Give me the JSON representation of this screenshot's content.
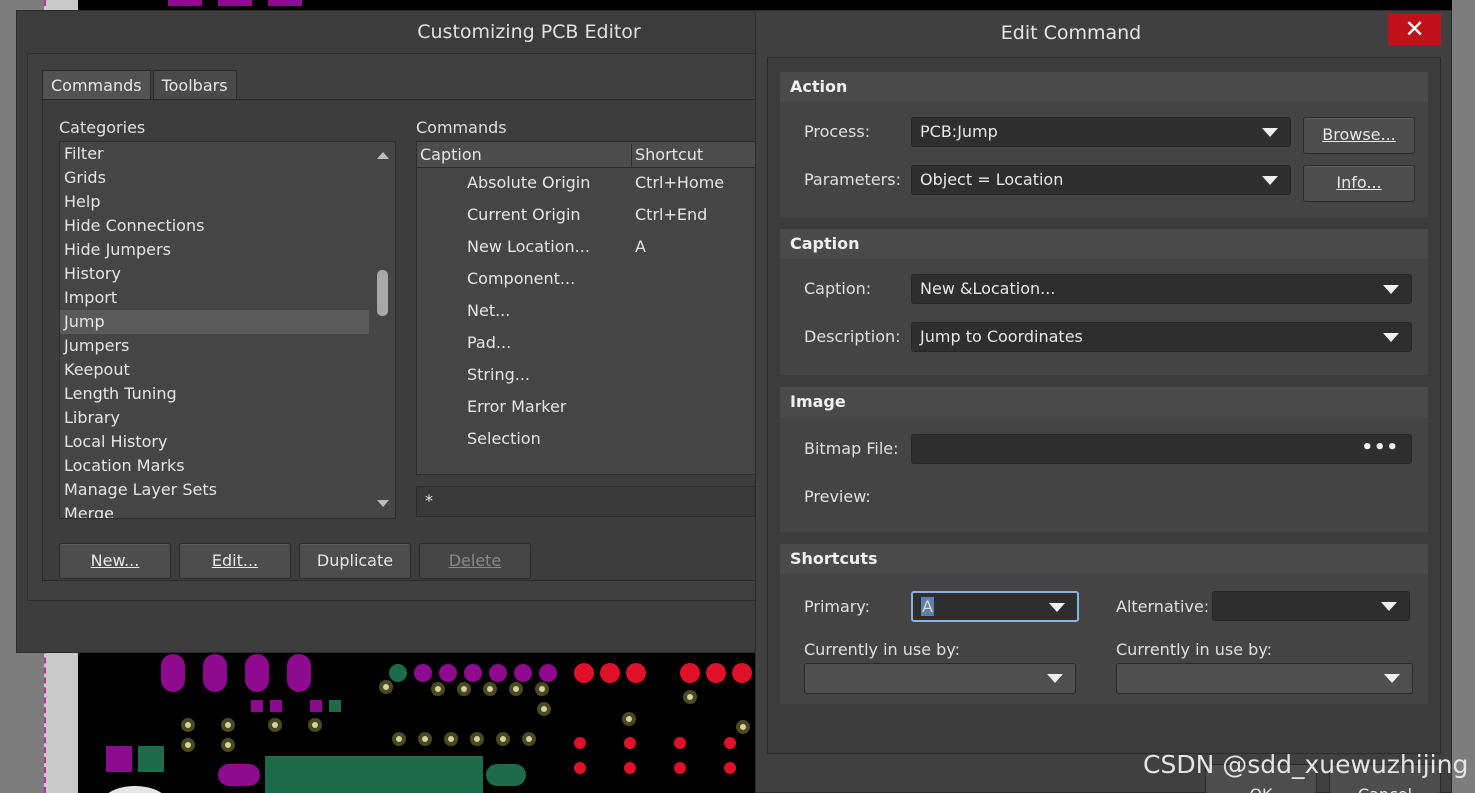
{
  "customize_dialog": {
    "title": "Customizing PCB Editor",
    "tabs": [
      {
        "label": "Commands",
        "active": true
      },
      {
        "label": "Toolbars",
        "active": false
      }
    ],
    "categories_label": "Categories",
    "categories": [
      "Filter",
      "Grids",
      "Help",
      "Hide Connections",
      "Hide Jumpers",
      "History",
      "Import",
      "Jump",
      "Jumpers",
      "Keepout",
      "Length Tuning",
      "Library",
      "Local History",
      "Location Marks",
      "Manage Layer Sets",
      "Merge"
    ],
    "selected_category": "Jump",
    "commands_label": "Commands",
    "columns": {
      "caption": "Caption",
      "shortcut": "Shortcut"
    },
    "commands": [
      {
        "caption": "Absolute Origin",
        "shortcut": "Ctrl+Home"
      },
      {
        "caption": "Current Origin",
        "shortcut": "Ctrl+End"
      },
      {
        "caption": "New Location...",
        "shortcut": "A"
      },
      {
        "caption": "Component...",
        "shortcut": ""
      },
      {
        "caption": "Net...",
        "shortcut": ""
      },
      {
        "caption": "Pad...",
        "shortcut": ""
      },
      {
        "caption": "String...",
        "shortcut": ""
      },
      {
        "caption": "Error Marker",
        "shortcut": ""
      },
      {
        "caption": "Selection",
        "shortcut": ""
      }
    ],
    "filter_value": "*",
    "buttons": {
      "new": "New...",
      "edit": "Edit...",
      "duplicate": "Duplicate",
      "delete": "Delete"
    }
  },
  "edit_dialog": {
    "title": "Edit Command",
    "close_glyph": "✕",
    "action": {
      "header": "Action",
      "process_label": "Process:",
      "process_value": "PCB:Jump",
      "parameters_label": "Parameters:",
      "parameters_value": "Object = Location",
      "browse_button": "Browse...",
      "info_button": "Info..."
    },
    "caption": {
      "header": "Caption",
      "caption_label": "Caption:",
      "caption_value": "New &Location...",
      "description_label": "Description:",
      "description_value": "Jump to Coordinates"
    },
    "image": {
      "header": "Image",
      "bitmap_label": "Bitmap File:",
      "bitmap_value": "",
      "bitmap_dots": "•••",
      "preview_label": "Preview:"
    },
    "shortcuts": {
      "header": "Shortcuts",
      "primary_label": "Primary:",
      "primary_value": "A",
      "alternative_label": "Alternative:",
      "alternative_value": "",
      "in_use_label_1": "Currently in use by:",
      "in_use_label_2": "Currently in use by:"
    },
    "ok_button": "OK",
    "cancel_button": "Cancel"
  },
  "watermark": "CSDN @sdd_xuewuzhijing",
  "colors": {
    "close_red": "#c0101a",
    "pcb_purple": "#8e0a8e",
    "pcb_red": "#e0102a",
    "pcb_green": "#1e6b4c",
    "focus_blue": "#8ab4e0"
  }
}
